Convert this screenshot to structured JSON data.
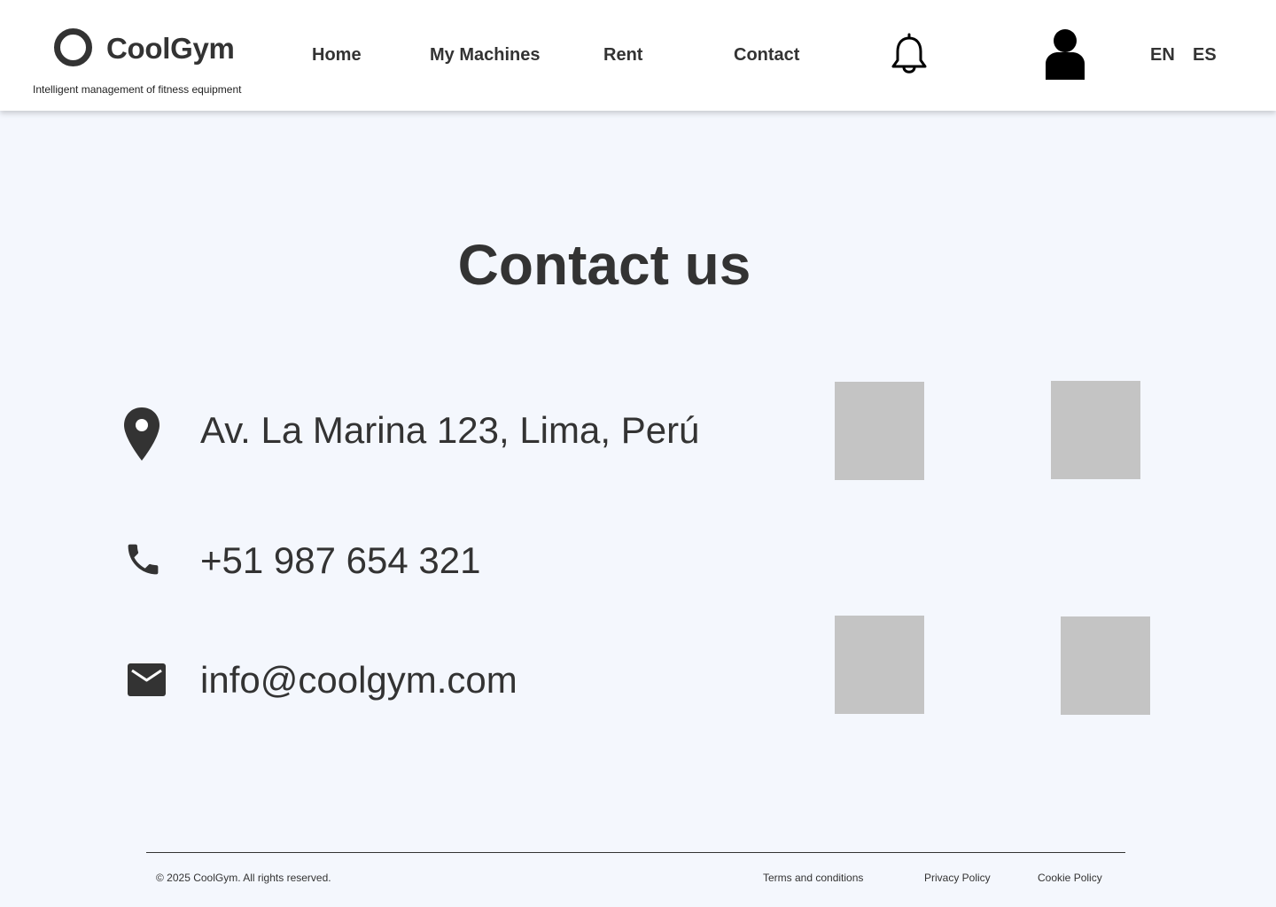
{
  "brand": {
    "name": "CoolGym",
    "tagline": "Intelligent management of fitness equipment"
  },
  "nav": {
    "home": "Home",
    "machines": "My Machines",
    "rent": "Rent",
    "contact": "Contact"
  },
  "icons": {
    "notifications": "bell-icon",
    "profile": "user-icon",
    "location": "map-pin-icon",
    "phone": "phone-icon",
    "email": "mail-icon"
  },
  "languages": [
    "EN",
    "ES"
  ],
  "main": {
    "title": "Contact us",
    "address": "Av. La Marina 123,  Lima, Perú",
    "phone": "+51 987 654 321",
    "email": "info@coolgym.com"
  },
  "footer": {
    "copyright": "© 2025 CoolGym. All rights reserved.",
    "terms": "Terms and conditions",
    "privacy": "Privacy Policy",
    "cookies": "Cookie Policy"
  },
  "colors": {
    "background": "#f4f7fd",
    "header": "#ffffff",
    "text": "#333333",
    "placeholder": "#c4c4c4"
  }
}
